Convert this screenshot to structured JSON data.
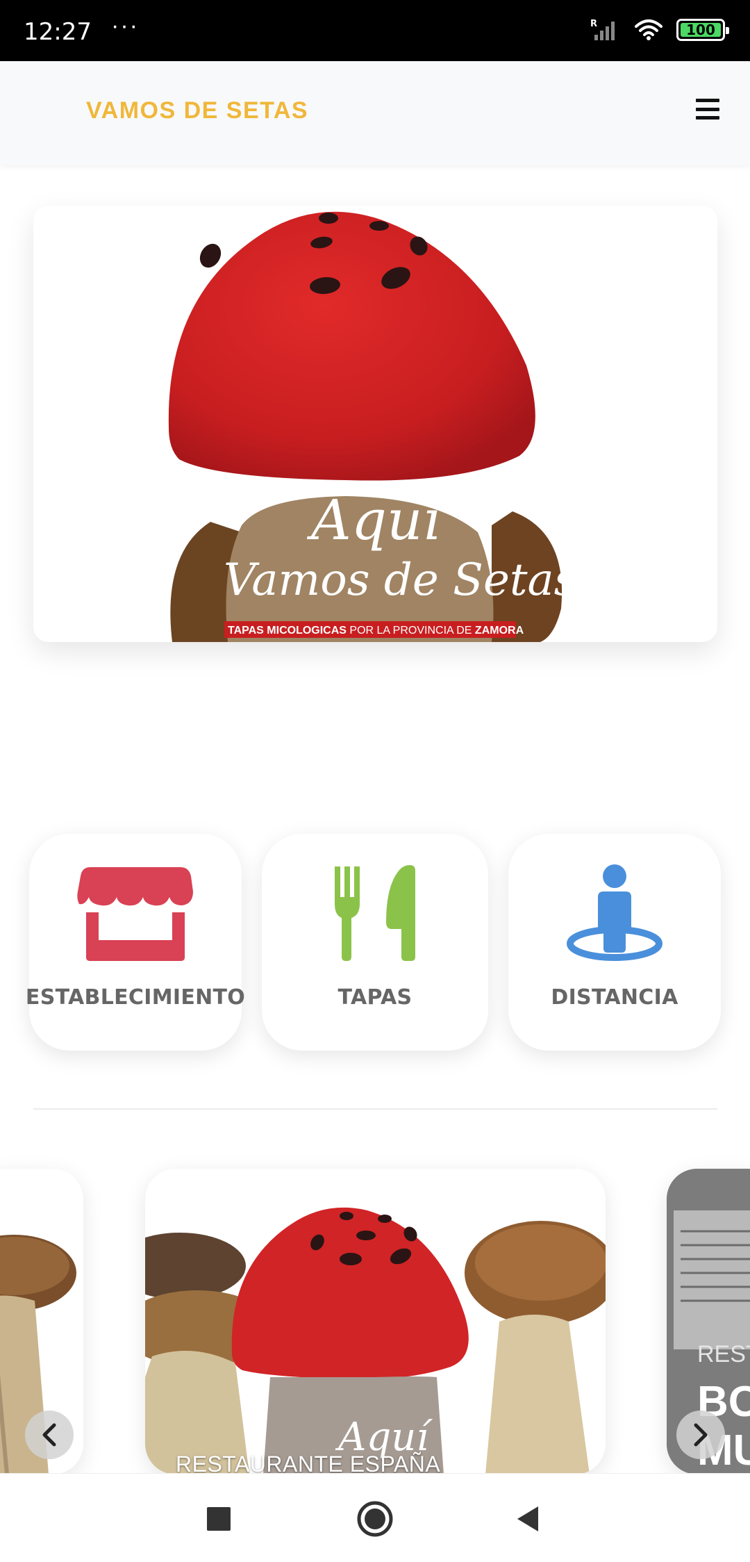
{
  "status_bar": {
    "time": "12:27",
    "dots": "···",
    "battery": "100",
    "signal_label": "R"
  },
  "header": {
    "brand": "VAMOS DE SETAS",
    "menu_icon": "hamburger-menu-icon"
  },
  "hero": {
    "script_line1": "Aquí",
    "script_line2": "Vamos de Setas",
    "banner_part1": "TAPAS MICOLOGICAS",
    "banner_part2": " POR LA PROVINCIA DE ",
    "banner_part3": "ZAMORA"
  },
  "categories": [
    {
      "label": "ESTABLECIMIENTO",
      "icon": "storefront-icon",
      "color": "#d94154"
    },
    {
      "label": "TAPAS",
      "icon": "fork-knife-icon",
      "color": "#8bc34a"
    },
    {
      "label": "DISTANCIA",
      "icon": "person-location-icon",
      "color": "#4a8fdb"
    }
  ],
  "carousel": {
    "center_label": "RESTAURANTE ESPAÑA",
    "center_script": "Aquí",
    "right_label_small": "REST",
    "right_label_big1": "BO",
    "right_label_big2": "MU"
  },
  "nav": {
    "recents": "square-icon",
    "home": "circle-home-icon",
    "back": "triangle-back-icon"
  }
}
